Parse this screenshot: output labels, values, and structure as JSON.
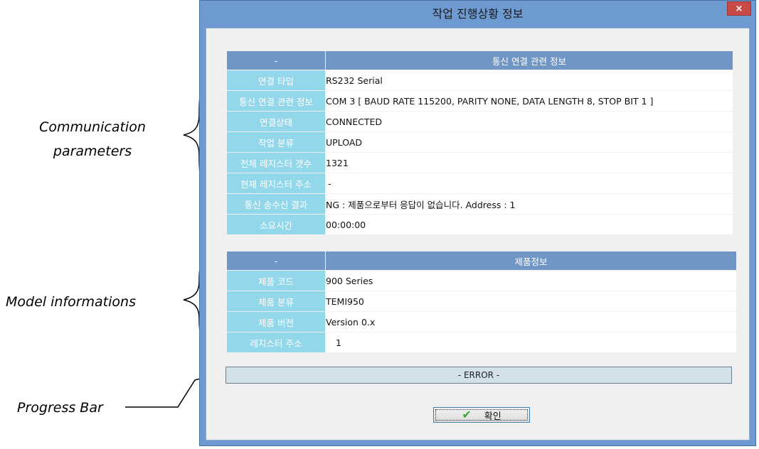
{
  "annotations": {
    "comm_line1": "Communication",
    "comm_line2": "parameters",
    "model": "Model informations",
    "progress": "Progress Bar"
  },
  "dialog": {
    "title": "작업 진행상황 정보",
    "close_symbol": "×"
  },
  "comm_table": {
    "header_left": "-",
    "header_right": "통신 연결 관련 정보",
    "rows": [
      {
        "label": "연결 타입",
        "value": "RS232 Serial"
      },
      {
        "label": "통신 연결 관련 정보",
        "value": "COM 3 [ BAUD RATE 115200, PARITY NONE, DATA LENGTH 8, STOP BIT 1 ]"
      },
      {
        "label": "연결상태",
        "value": "CONNECTED"
      },
      {
        "label": "작업 분류",
        "value": "UPLOAD"
      },
      {
        "label": "전체 레지스터 갯수",
        "value": "1321"
      },
      {
        "label": "현재 레지스터 주소",
        "value": "-"
      },
      {
        "label": "통신 송수신 결과",
        "value": "NG : 제품으로부터 응답이 없습니다. Address : 1"
      },
      {
        "label": "소요시간",
        "value": "00:00:00"
      }
    ]
  },
  "model_table": {
    "header_left": "-",
    "header_right": "제품정보",
    "rows": [
      {
        "label": "제품 코드",
        "value": "900 Series"
      },
      {
        "label": "제품 분류",
        "value": "TEMI950"
      },
      {
        "label": "제품 버전",
        "value": "Version 0.x"
      },
      {
        "label": "레지스터 주소",
        "value": "1"
      }
    ]
  },
  "progress_bar": {
    "text": "- ERROR -"
  },
  "ok_button": {
    "label": "확인",
    "icon": "checkmark-icon",
    "icon_color": "#3ba33b"
  },
  "colors": {
    "header_bg": "#6f96c4",
    "label_bg": "#93d7ea",
    "window_frame": "#6d9bd1",
    "close_button": "#c74a46"
  }
}
